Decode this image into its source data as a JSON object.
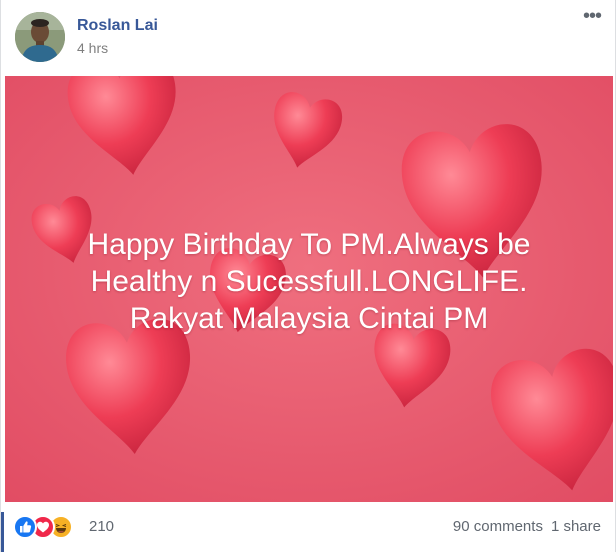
{
  "post": {
    "author": "Roslan Lai",
    "timestamp": "4 hrs",
    "more_icon": "•••",
    "text_lines": [
      "Happy Birthday To PM.Always be",
      "Healthy n Sucessfull.LONGLIFE.",
      "Rakyat Malaysia Cintai PM"
    ],
    "background_color": "#e9586b",
    "icons": [
      "avatar",
      "more-options-icon",
      "like-reaction-icon",
      "love-reaction-icon",
      "haha-reaction-icon"
    ]
  },
  "footer": {
    "reaction_count": "210",
    "comments": "90 comments",
    "shares": "1 share"
  },
  "colors": {
    "author_link": "#385898",
    "like": "#1877f2",
    "love": "#f0284a",
    "haha": "#f7b125",
    "meta_text": "#606770"
  }
}
